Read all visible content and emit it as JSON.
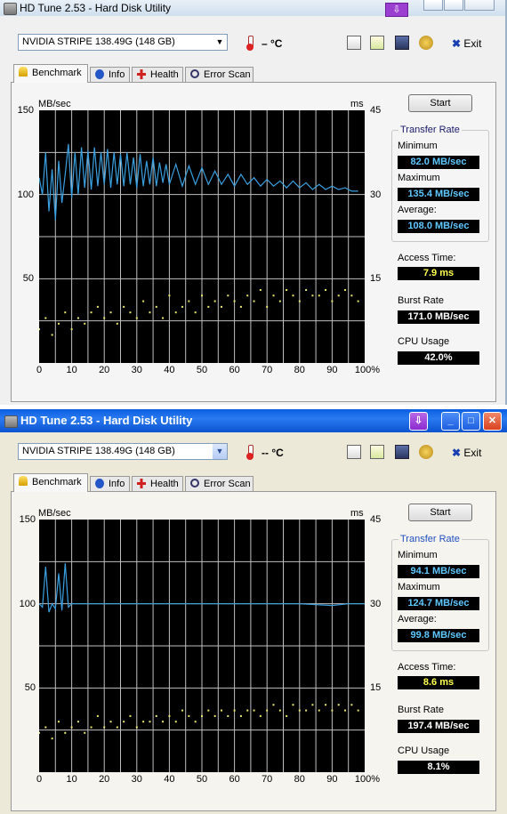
{
  "windows": [
    {
      "title": "HD Tune 2.53 - Hard Disk Utility",
      "drive": "NVIDIA  STRIPE   138.49G (148 GB)",
      "temperature": "– °C",
      "exit_label": "Exit",
      "tabs": [
        "Benchmark",
        "Info",
        "Health",
        "Error Scan"
      ],
      "start_label": "Start",
      "transfer_rate": {
        "legend": "Transfer Rate",
        "minimum_label": "Minimum",
        "minimum": "82.0 MB/sec",
        "maximum_label": "Maximum",
        "maximum": "135.4 MB/sec",
        "average_label": "Average:",
        "average": "108.0 MB/sec"
      },
      "access_time_label": "Access Time:",
      "access_time": "7.9 ms",
      "burst_rate_label": "Burst Rate",
      "burst_rate": "171.0 MB/sec",
      "cpu_usage_label": "CPU Usage",
      "cpu_usage": "42.0%"
    },
    {
      "title": "HD Tune 2.53 - Hard Disk Utility",
      "drive": "NVIDIA  STRIPE   138.49G (148 GB)",
      "temperature": "-- °C",
      "exit_label": "Exit",
      "tabs": [
        "Benchmark",
        "Info",
        "Health",
        "Error Scan"
      ],
      "start_label": "Start",
      "transfer_rate": {
        "legend": "Transfer Rate",
        "minimum_label": "Minimum",
        "minimum": "94.1 MB/sec",
        "maximum_label": "Maximum",
        "maximum": "124.7 MB/sec",
        "average_label": "Average:",
        "average": "99.8 MB/sec"
      },
      "access_time_label": "Access Time:",
      "access_time": "8.6 ms",
      "burst_rate_label": "Burst Rate",
      "burst_rate": "197.4 MB/sec",
      "cpu_usage_label": "CPU Usage",
      "cpu_usage": "8.1%"
    }
  ],
  "chart_data": [
    {
      "type": "line",
      "ylabel": "MB/sec",
      "y2label": "ms",
      "ylim": [
        0,
        150
      ],
      "y2lim": [
        0,
        45
      ],
      "yticks": [
        50,
        100,
        150
      ],
      "y2ticks": [
        15,
        30,
        45
      ],
      "xticks": [
        "0",
        "10",
        "20",
        "30",
        "40",
        "50",
        "60",
        "70",
        "80",
        "90",
        "100%"
      ],
      "xlim": [
        0,
        100
      ],
      "grid": true,
      "colors": {
        "transfer": "#3aa0e0",
        "access": "#e8e870"
      },
      "series": [
        {
          "x": [
            0,
            1,
            2,
            3,
            4,
            5,
            6,
            7,
            8,
            9,
            10,
            11,
            12,
            13,
            14,
            15,
            16,
            17,
            18,
            19,
            20,
            21,
            22,
            23,
            24,
            25,
            26,
            27,
            28,
            29,
            30,
            31,
            32,
            33,
            34,
            35,
            36,
            37,
            38,
            39,
            40,
            42,
            44,
            46,
            48,
            50,
            52,
            54,
            56,
            58,
            60,
            62,
            64,
            66,
            68,
            70,
            72,
            74,
            76,
            78,
            80,
            82,
            84,
            86,
            88,
            90,
            92,
            94,
            96,
            98
          ],
          "y": [
            110,
            100,
            125,
            90,
            115,
            85,
            120,
            95,
            112,
            130,
            98,
            125,
            100,
            128,
            104,
            126,
            103,
            128,
            105,
            125,
            106,
            127,
            104,
            125,
            106,
            124,
            105,
            125,
            106,
            122,
            104,
            124,
            105,
            120,
            106,
            122,
            105,
            119,
            107,
            118,
            106,
            118,
            105,
            117,
            106,
            116,
            106,
            114,
            106,
            112,
            105,
            112,
            106,
            110,
            105,
            109,
            105,
            108,
            104,
            108,
            104,
            107,
            103,
            106,
            103,
            105,
            103,
            104,
            102,
            102
          ]
        },
        {
          "x": [
            0,
            2,
            4,
            6,
            8,
            10,
            12,
            14,
            16,
            18,
            20,
            22,
            24,
            26,
            28,
            30,
            32,
            34,
            36,
            38,
            40,
            42,
            44,
            46,
            48,
            50,
            52,
            54,
            56,
            58,
            60,
            62,
            64,
            66,
            68,
            70,
            72,
            74,
            76,
            78,
            80,
            82,
            84,
            86,
            88,
            90,
            92,
            94,
            96,
            98
          ],
          "y": [
            6,
            8,
            5,
            7,
            9,
            6,
            8,
            7,
            9,
            10,
            8,
            9,
            7,
            10,
            9,
            8,
            11,
            9,
            10,
            8,
            12,
            9,
            10,
            11,
            9,
            12,
            10,
            11,
            10,
            12,
            11,
            10,
            12,
            11,
            13,
            10,
            12,
            11,
            13,
            12,
            11,
            13,
            12,
            12,
            13,
            11,
            12,
            13,
            12,
            11
          ]
        }
      ]
    },
    {
      "type": "line",
      "ylabel": "MB/sec",
      "y2label": "ms",
      "ylim": [
        0,
        150
      ],
      "y2lim": [
        0,
        45
      ],
      "yticks": [
        50,
        100,
        150
      ],
      "y2ticks": [
        15,
        30,
        45
      ],
      "xticks": [
        "0",
        "10",
        "20",
        "30",
        "40",
        "50",
        "60",
        "70",
        "80",
        "90",
        "100%"
      ],
      "xlim": [
        0,
        100
      ],
      "grid": true,
      "colors": {
        "transfer": "#3aa0e0",
        "access": "#e8e870"
      },
      "series": [
        {
          "x": [
            0,
            1,
            2,
            3,
            4,
            5,
            6,
            7,
            8,
            9,
            10,
            12,
            15,
            20,
            25,
            30,
            40,
            50,
            60,
            70,
            80,
            90,
            95,
            100
          ],
          "y": [
            100,
            98,
            122,
            95,
            100,
            97,
            118,
            96,
            124,
            98,
            100,
            100,
            100,
            100,
            100,
            100,
            100,
            100,
            100,
            100,
            100,
            99,
            100,
            100
          ]
        },
        {
          "x": [
            0,
            2,
            4,
            6,
            8,
            10,
            12,
            14,
            16,
            18,
            20,
            22,
            24,
            26,
            28,
            30,
            32,
            34,
            36,
            38,
            40,
            42,
            44,
            46,
            48,
            50,
            52,
            54,
            56,
            58,
            60,
            62,
            64,
            66,
            68,
            70,
            72,
            74,
            76,
            78,
            80,
            82,
            84,
            86,
            88,
            90,
            92,
            94,
            96,
            98
          ],
          "y": [
            7,
            8,
            6,
            9,
            7,
            8,
            9,
            7,
            8,
            10,
            8,
            9,
            8,
            9,
            10,
            8,
            9,
            9,
            10,
            9,
            10,
            9,
            11,
            10,
            9,
            10,
            11,
            10,
            11,
            10,
            11,
            10,
            11,
            11,
            10,
            11,
            12,
            11,
            10,
            12,
            11,
            11,
            12,
            11,
            12,
            11,
            12,
            11,
            12,
            11
          ]
        }
      ]
    }
  ]
}
